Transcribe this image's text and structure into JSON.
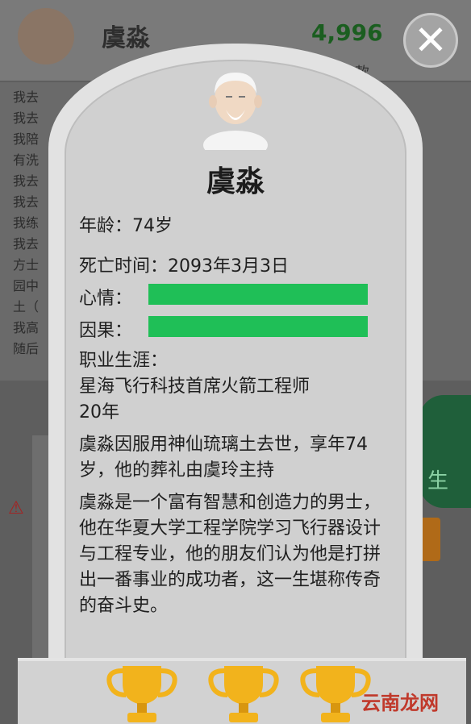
{
  "background": {
    "player_name": "虞淼",
    "money": "4,996",
    "sub_label": "款",
    "log_lines": [
      "我去",
      "我去",
      "我陪                                                部没",
      "有洗",
      "我去",
      "我去",
      "我练",
      "我去",
      "方士                                                蟠桃",
      "园中                                                琉璃",
      "土（",
      "我高                                                诗，",
      "随后"
    ],
    "side_button_label": "生"
  },
  "close_icon": "✕",
  "tombstone": {
    "name": "虞淼",
    "age_label": "年龄：",
    "age_value": "74岁",
    "death_label": "死亡时间：",
    "death_value": "2093年3月3日",
    "mood_label": "心情：",
    "mood_value": 1.0,
    "karma_label": "因果：",
    "karma_value": 1.0,
    "career_label": "职业生涯：",
    "career_line1": "星海飞行科技首席火箭工程师",
    "career_line2": "20年",
    "death_note": "虞淼因服用神仙琉璃土去世，享年74岁，他的葬礼由虞玲主持",
    "biography": "虞淼是一个富有智慧和创造力的男士，他在华夏大学工程学院学习飞行器设计与工程专业，他的朋友们认为他是打拼出一番事业的成功者，这一生堪称传奇的奋斗史。"
  },
  "trophies": [
    "trophy-icon",
    "trophy-icon",
    "trophy-icon"
  ],
  "watermark": "云南龙网",
  "colors": {
    "bar": "#1fbf57",
    "stone": "#d0d0d0"
  }
}
